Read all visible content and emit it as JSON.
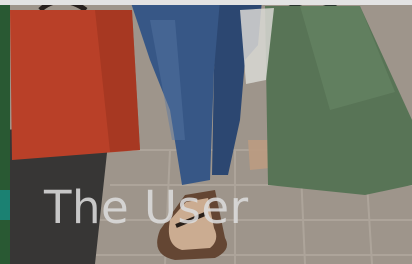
{
  "caption": {
    "text": "The User"
  },
  "scene": {
    "icons": [
      "red-shopping-bag-icon",
      "green-shopping-bag-icon",
      "jeans-legs-icon",
      "sandal-icon",
      "tile-floor-icon"
    ],
    "colors": {
      "floor": "#a99f92",
      "tile_grout": "#b8aea2",
      "red_bag": "#c8452b",
      "green_bag": "#5f7b5c",
      "jeans": "#3c5f92",
      "shadow": "#2a2f35"
    }
  }
}
